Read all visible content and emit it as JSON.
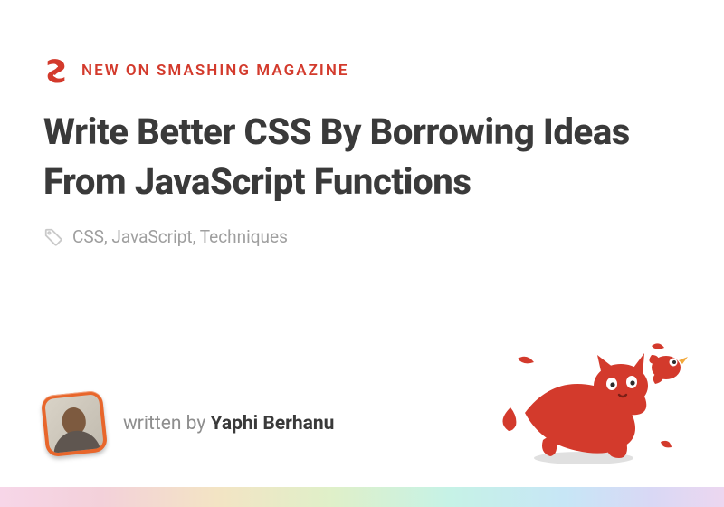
{
  "brand": {
    "color": "#d33a2c"
  },
  "kicker": "NEW ON SMASHING MAGAZINE",
  "title": "Write Better CSS By Borrowing Ideas From JavaScript Functions",
  "tags": "CSS, JavaScript, Techniques",
  "byline": {
    "prefix": "written by ",
    "author": "Yaphi Berhanu"
  }
}
